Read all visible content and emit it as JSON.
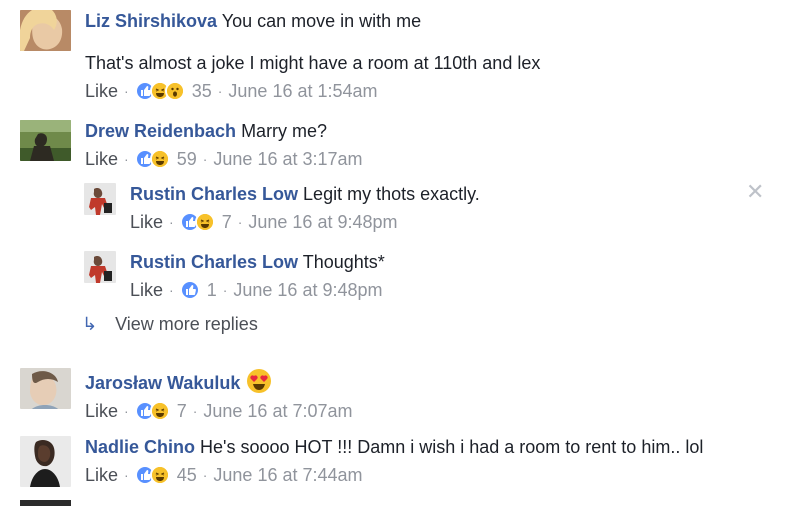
{
  "comments": [
    {
      "name": "Liz Shirshikova",
      "text": "You can move in with me",
      "text2": "That's almost a joke I might have a room at 110th and lex",
      "like": "Like",
      "count": "35",
      "time": "June 16 at 1:54am",
      "reactions": [
        "like",
        "haha",
        "wow"
      ]
    },
    {
      "name": "Drew Reidenbach",
      "text": "Marry me?",
      "like": "Like",
      "count": "59",
      "time": "June 16 at 3:17am",
      "reactions": [
        "like",
        "haha"
      ]
    },
    {
      "name": "Jarosław Wakuluk",
      "text": "",
      "like": "Like",
      "count": "7",
      "time": "June 16 at 7:07am",
      "reactions": [
        "like",
        "haha"
      ],
      "emoji": "heart-eyes"
    },
    {
      "name": "Nadlie Chino",
      "text": "He's soooo HOT !!! Damn i wish i had a room to rent to him.. lol",
      "like": "Like",
      "count": "45",
      "time": "June 16 at 7:44am",
      "reactions": [
        "like",
        "haha"
      ]
    }
  ],
  "replies": [
    {
      "name": "Rustin Charles Low",
      "text": "Legit my thots exactly.",
      "like": "Like",
      "count": "7",
      "time": "June 16 at 9:48pm",
      "reactions": [
        "like",
        "haha"
      ]
    },
    {
      "name": "Rustin Charles Low",
      "text": "Thoughts*",
      "like": "Like",
      "count": "1",
      "time": "June 16 at 9:48pm",
      "reactions": [
        "like"
      ]
    }
  ],
  "view_more": "View more replies",
  "separator": "·",
  "colors": {
    "name": "#365899",
    "like_react": "#5890ff",
    "haha_react": "#f7c12a",
    "meta": "#90949c"
  }
}
